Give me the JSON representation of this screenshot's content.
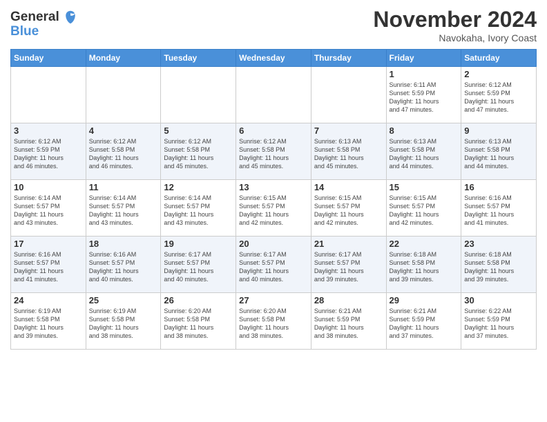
{
  "header": {
    "logo_line1": "General",
    "logo_line2": "Blue",
    "month": "November 2024",
    "location": "Navokaha, Ivory Coast"
  },
  "days_of_week": [
    "Sunday",
    "Monday",
    "Tuesday",
    "Wednesday",
    "Thursday",
    "Friday",
    "Saturday"
  ],
  "weeks": [
    [
      {
        "day": "",
        "info": ""
      },
      {
        "day": "",
        "info": ""
      },
      {
        "day": "",
        "info": ""
      },
      {
        "day": "",
        "info": ""
      },
      {
        "day": "",
        "info": ""
      },
      {
        "day": "1",
        "info": "Sunrise: 6:11 AM\nSunset: 5:59 PM\nDaylight: 11 hours\nand 47 minutes."
      },
      {
        "day": "2",
        "info": "Sunrise: 6:12 AM\nSunset: 5:59 PM\nDaylight: 11 hours\nand 47 minutes."
      }
    ],
    [
      {
        "day": "3",
        "info": "Sunrise: 6:12 AM\nSunset: 5:59 PM\nDaylight: 11 hours\nand 46 minutes."
      },
      {
        "day": "4",
        "info": "Sunrise: 6:12 AM\nSunset: 5:58 PM\nDaylight: 11 hours\nand 46 minutes."
      },
      {
        "day": "5",
        "info": "Sunrise: 6:12 AM\nSunset: 5:58 PM\nDaylight: 11 hours\nand 45 minutes."
      },
      {
        "day": "6",
        "info": "Sunrise: 6:12 AM\nSunset: 5:58 PM\nDaylight: 11 hours\nand 45 minutes."
      },
      {
        "day": "7",
        "info": "Sunrise: 6:13 AM\nSunset: 5:58 PM\nDaylight: 11 hours\nand 45 minutes."
      },
      {
        "day": "8",
        "info": "Sunrise: 6:13 AM\nSunset: 5:58 PM\nDaylight: 11 hours\nand 44 minutes."
      },
      {
        "day": "9",
        "info": "Sunrise: 6:13 AM\nSunset: 5:58 PM\nDaylight: 11 hours\nand 44 minutes."
      }
    ],
    [
      {
        "day": "10",
        "info": "Sunrise: 6:14 AM\nSunset: 5:57 PM\nDaylight: 11 hours\nand 43 minutes."
      },
      {
        "day": "11",
        "info": "Sunrise: 6:14 AM\nSunset: 5:57 PM\nDaylight: 11 hours\nand 43 minutes."
      },
      {
        "day": "12",
        "info": "Sunrise: 6:14 AM\nSunset: 5:57 PM\nDaylight: 11 hours\nand 43 minutes."
      },
      {
        "day": "13",
        "info": "Sunrise: 6:15 AM\nSunset: 5:57 PM\nDaylight: 11 hours\nand 42 minutes."
      },
      {
        "day": "14",
        "info": "Sunrise: 6:15 AM\nSunset: 5:57 PM\nDaylight: 11 hours\nand 42 minutes."
      },
      {
        "day": "15",
        "info": "Sunrise: 6:15 AM\nSunset: 5:57 PM\nDaylight: 11 hours\nand 42 minutes."
      },
      {
        "day": "16",
        "info": "Sunrise: 6:16 AM\nSunset: 5:57 PM\nDaylight: 11 hours\nand 41 minutes."
      }
    ],
    [
      {
        "day": "17",
        "info": "Sunrise: 6:16 AM\nSunset: 5:57 PM\nDaylight: 11 hours\nand 41 minutes."
      },
      {
        "day": "18",
        "info": "Sunrise: 6:16 AM\nSunset: 5:57 PM\nDaylight: 11 hours\nand 40 minutes."
      },
      {
        "day": "19",
        "info": "Sunrise: 6:17 AM\nSunset: 5:57 PM\nDaylight: 11 hours\nand 40 minutes."
      },
      {
        "day": "20",
        "info": "Sunrise: 6:17 AM\nSunset: 5:57 PM\nDaylight: 11 hours\nand 40 minutes."
      },
      {
        "day": "21",
        "info": "Sunrise: 6:17 AM\nSunset: 5:57 PM\nDaylight: 11 hours\nand 39 minutes."
      },
      {
        "day": "22",
        "info": "Sunrise: 6:18 AM\nSunset: 5:58 PM\nDaylight: 11 hours\nand 39 minutes."
      },
      {
        "day": "23",
        "info": "Sunrise: 6:18 AM\nSunset: 5:58 PM\nDaylight: 11 hours\nand 39 minutes."
      }
    ],
    [
      {
        "day": "24",
        "info": "Sunrise: 6:19 AM\nSunset: 5:58 PM\nDaylight: 11 hours\nand 39 minutes."
      },
      {
        "day": "25",
        "info": "Sunrise: 6:19 AM\nSunset: 5:58 PM\nDaylight: 11 hours\nand 38 minutes."
      },
      {
        "day": "26",
        "info": "Sunrise: 6:20 AM\nSunset: 5:58 PM\nDaylight: 11 hours\nand 38 minutes."
      },
      {
        "day": "27",
        "info": "Sunrise: 6:20 AM\nSunset: 5:58 PM\nDaylight: 11 hours\nand 38 minutes."
      },
      {
        "day": "28",
        "info": "Sunrise: 6:21 AM\nSunset: 5:59 PM\nDaylight: 11 hours\nand 38 minutes."
      },
      {
        "day": "29",
        "info": "Sunrise: 6:21 AM\nSunset: 5:59 PM\nDaylight: 11 hours\nand 37 minutes."
      },
      {
        "day": "30",
        "info": "Sunrise: 6:22 AM\nSunset: 5:59 PM\nDaylight: 11 hours\nand 37 minutes."
      }
    ]
  ]
}
